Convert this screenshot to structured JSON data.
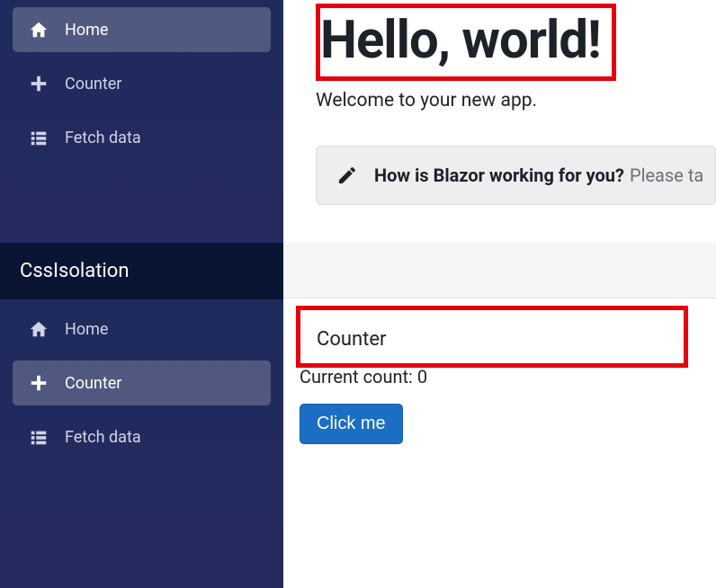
{
  "app1": {
    "nav": [
      {
        "label": "Home",
        "icon": "home",
        "active": true
      },
      {
        "label": "Counter",
        "icon": "plus",
        "active": false
      },
      {
        "label": "Fetch data",
        "icon": "list",
        "active": false
      }
    ],
    "title": "Hello, world!",
    "welcome": "Welcome to your new app.",
    "survey_bold": "How is Blazor working for you?",
    "survey_tail": "Please ta"
  },
  "app2": {
    "brand": "CssIsolation",
    "nav": [
      {
        "label": "Home",
        "icon": "home",
        "active": false
      },
      {
        "label": "Counter",
        "icon": "plus",
        "active": true
      },
      {
        "label": "Fetch data",
        "icon": "list",
        "active": false
      }
    ],
    "page_title": "Counter",
    "count_label": "Current count: 0",
    "button_label": "Click me"
  }
}
